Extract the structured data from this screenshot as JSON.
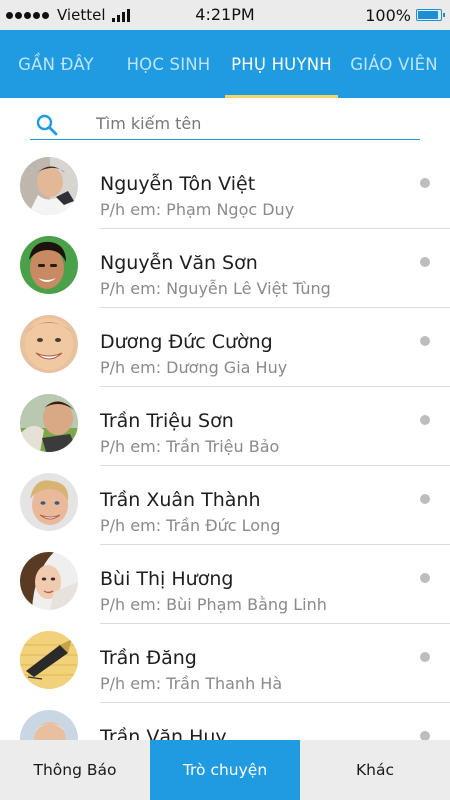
{
  "status_bar": {
    "carrier": "Viettel",
    "time": "4:21PM",
    "battery": "100%",
    "battery_level": 1.0
  },
  "tabs": [
    {
      "label": "GẦN ĐÂY",
      "active": false
    },
    {
      "label": "HỌC SINH",
      "active": false
    },
    {
      "label": "PHỤ HUYNH",
      "active": true
    },
    {
      "label": "GIÁO VIÊN",
      "active": false
    }
  ],
  "search": {
    "placeholder": "Tìm kiếm tên",
    "icon": "search-icon"
  },
  "contacts": [
    {
      "name": "Nguyễn Tôn Việt",
      "sub": "P/h em: Phạm Ngọc Duy"
    },
    {
      "name": "Nguyễn Văn Sơn",
      "sub": "P/h em: Nguyễn Lê Việt Tùng"
    },
    {
      "name": "Dương Đức Cường",
      "sub": "P/h em: Dương Gia Huy"
    },
    {
      "name": "Trần Triệu Sơn",
      "sub": "P/h em: Trần Triệu Bảo"
    },
    {
      "name": "Trần Xuân Thành",
      "sub": "P/h em: Trần Đức Long"
    },
    {
      "name": "Bùi Thị Hương",
      "sub": "P/h em: Bùi Phạm Bằng Linh"
    },
    {
      "name": "Trần Đăng",
      "sub": "P/h em: Trần Thanh Hà"
    },
    {
      "name": "Trần Văn Huy",
      "sub": ""
    }
  ],
  "bottom_nav": [
    {
      "label": "Thông Báo",
      "active": false
    },
    {
      "label": "Trò chuyện",
      "active": true
    },
    {
      "label": "Khác",
      "active": false
    }
  ],
  "colors": {
    "primary": "#1f9be1",
    "tab_indicator": "#f5d56a",
    "status_dot": "#bdbdbd"
  }
}
